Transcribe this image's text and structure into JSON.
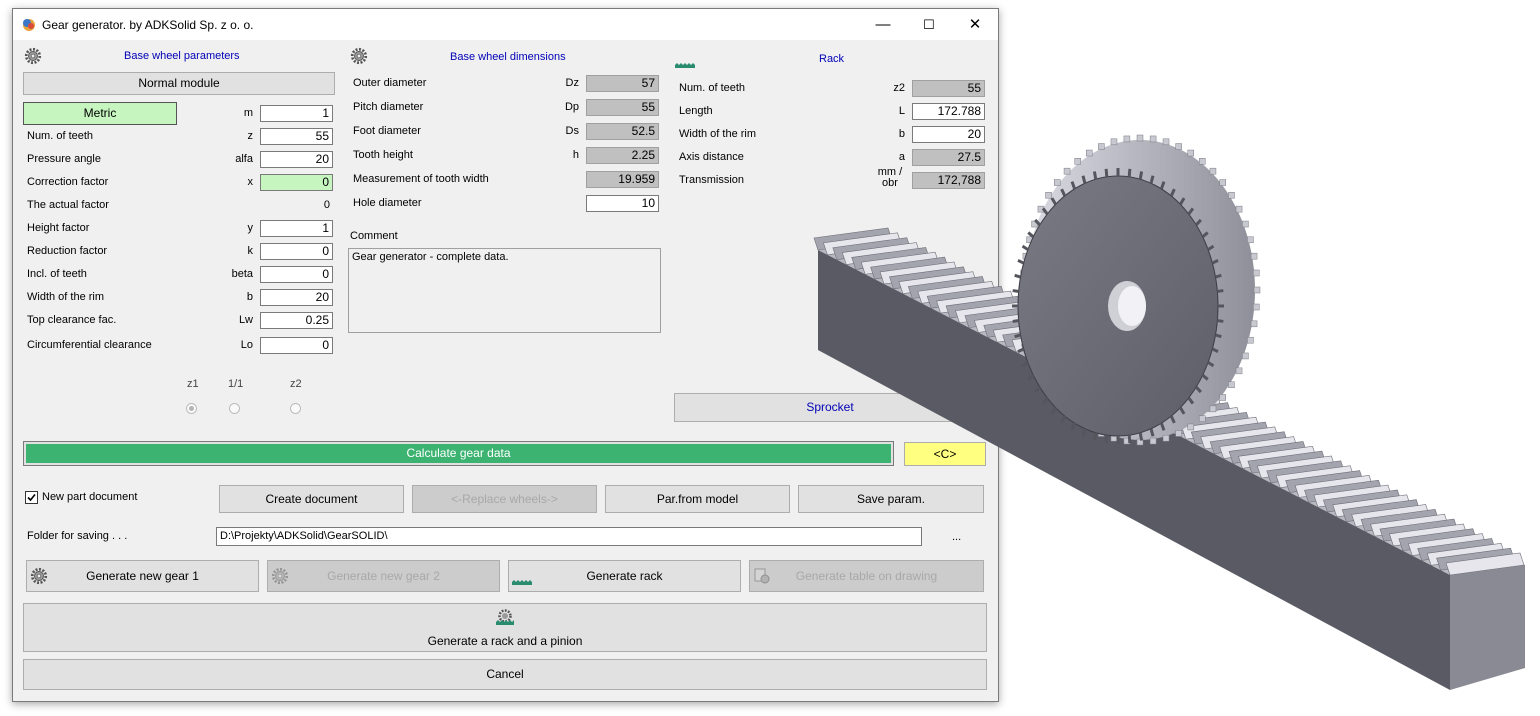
{
  "window": {
    "title": "Gear generator. by  ADKSolid Sp. z o. o.",
    "minimize": "—",
    "maximize": "☐",
    "close": "✕"
  },
  "base_params": {
    "header": "Base wheel parameters",
    "module_button": "Normal module",
    "metric_button": "Metric",
    "rows": [
      {
        "label": "",
        "symbol": "m",
        "value": "1"
      },
      {
        "label": "Num. of teeth",
        "symbol": "z",
        "value": "55"
      },
      {
        "label": "Pressure angle",
        "symbol": "alfa",
        "value": "20"
      },
      {
        "label": "Correction factor",
        "symbol": "x",
        "value": "0"
      },
      {
        "label": "The actual factor",
        "symbol": "",
        "value": "0"
      },
      {
        "label": "Height factor",
        "symbol": "y",
        "value": "1"
      },
      {
        "label": "Reduction factor",
        "symbol": "k",
        "value": "0"
      },
      {
        "label": "Incl. of teeth",
        "symbol": "beta",
        "value": "0"
      },
      {
        "label": "Width of the rim",
        "symbol": "b",
        "value": "20"
      },
      {
        "label": "Top clearance fac.",
        "symbol": "Lw",
        "value": "0.25"
      },
      {
        "label": "Circumferential clearance",
        "symbol": "Lo",
        "value": "0"
      }
    ],
    "radio_labels": [
      "z1",
      "1/1",
      "z2"
    ]
  },
  "dimensions": {
    "header": "Base wheel dimensions",
    "rows": [
      {
        "label": "Outer diameter",
        "symbol": "Dz",
        "value": "57"
      },
      {
        "label": "Pitch diameter",
        "symbol": "Dp",
        "value": "55"
      },
      {
        "label": "Foot diameter",
        "symbol": "Ds",
        "value": "52.5"
      },
      {
        "label": "Tooth height",
        "symbol": "h",
        "value": "2.25"
      },
      {
        "label": "Measurement of tooth width",
        "symbol": "",
        "value": "19.959"
      },
      {
        "label": "Hole diameter",
        "symbol": "",
        "value": "10"
      }
    ],
    "comment_label": "Comment",
    "comment_text": "Gear generator - complete data."
  },
  "rack": {
    "header": "Rack",
    "rows": [
      {
        "label": "Num. of teeth",
        "symbol": "z2",
        "value": "55"
      },
      {
        "label": "Length",
        "symbol": "L",
        "value": "172.788"
      },
      {
        "label": "Width of the rim",
        "symbol": "b",
        "value": "20"
      },
      {
        "label": "Axis distance",
        "symbol": "a",
        "value": "27.5"
      },
      {
        "label": "Transmission",
        "symbol": "mm / obr",
        "value": "172,788"
      }
    ],
    "sprocket_button": "Sprocket"
  },
  "actions": {
    "calculate": "Calculate gear data",
    "c_button": "<C>",
    "new_part_label": "New part document",
    "create_document": "Create document",
    "replace_wheels": "<-Replace wheels->",
    "par_from_model": "Par.from model",
    "save_param": "Save param.",
    "folder_label": "Folder for saving . . .",
    "folder_path": "D:\\Projekty\\ADKSolid\\GearSOLID\\",
    "browse": "...",
    "generate_gear1": "Generate new gear 1",
    "generate_gear2": "Generate new gear 2",
    "generate_rack": "Generate rack",
    "generate_table": "Generate table on drawing",
    "generate_rack_pinion": "Generate a rack and a pinion",
    "cancel": "Cancel"
  },
  "colors": {
    "calculate_bar": "#3cb371",
    "c_button": "#ffff80",
    "highlight_field": "#c6f5c0",
    "header_text": "#0000b8"
  }
}
